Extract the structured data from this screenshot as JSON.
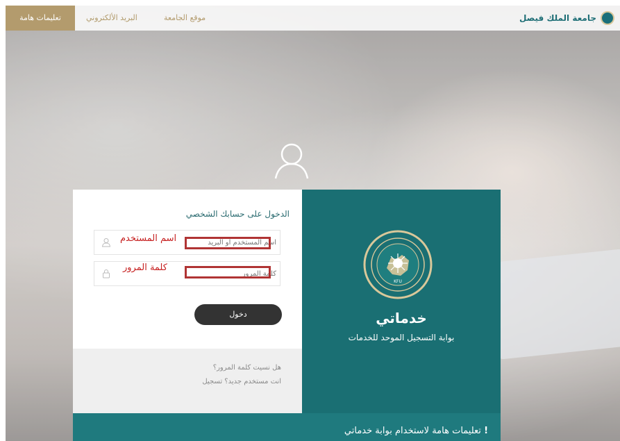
{
  "colors": {
    "accent": "#1a6f73",
    "gold": "#b39b6d",
    "button": "#333333",
    "annotation": "#c62020"
  },
  "nav": {
    "brand": "جامعة الملك فيصل",
    "university_site": "موقع الجامعة",
    "email": "البريد الألكتروني",
    "important": "تعليمات هامة"
  },
  "login": {
    "title": "الدخول على حسابك الشخصي",
    "username_placeholder": "اسم المستخدم او البريد",
    "password_placeholder": "كلمة المرور",
    "username_annotation": "اسم المستخدم",
    "password_annotation": "كلمة المرور",
    "submit": "دخول",
    "forgot": "هل نسيت كلمة المرور؟",
    "register": "انت مستخدم جديد؟ تسجيل"
  },
  "panel": {
    "title": "خدماتي",
    "subtitle": "بوابة التسجيل الموحد للخدمات",
    "seal_text": "KFU"
  },
  "instructions": {
    "icon": "!",
    "text": "تعليمات هامة لاستخدام بوابة خدماتي"
  }
}
